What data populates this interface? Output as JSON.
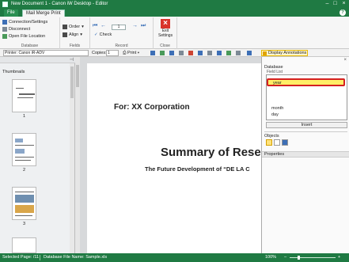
{
  "window": {
    "title": "New Document 1 - Canon iW Desktop - Editor",
    "minimize_glyph": "–",
    "maximize_glyph": "□",
    "close_glyph": "×"
  },
  "tabs": {
    "file": "File",
    "mail_merge_print": "Mail Merge Print",
    "help_glyph": "?"
  },
  "ribbon": {
    "database_group": {
      "label": "Database",
      "items": [
        "Connection/Settings",
        "Disconnect",
        "Open File Location"
      ]
    },
    "fields_group": {
      "label": "Fields",
      "order": "Order",
      "align": "Align"
    },
    "record_group": {
      "label": "Record",
      "check": "Check",
      "record_number": "1"
    },
    "close_group": {
      "label": "Close",
      "exit_line1": "Exit",
      "exit_line2": "Settings"
    }
  },
  "toolbar2": {
    "printer": "Printer: Canon iR-ADV",
    "copies_label": "Copies:",
    "copies_value": "1",
    "print": "Print",
    "display_annotations": "Display Annotations"
  },
  "thumbnails": {
    "label": "Thumbnails",
    "pin_glyph": "⊣",
    "pages": [
      "1",
      "2",
      "3"
    ]
  },
  "document": {
    "for_line": "For: XX Corporation",
    "summary": "Summary of Rese",
    "future": "The Future Development of “DE LA C"
  },
  "right_panel": {
    "close_glyph": "×",
    "database_label": "Database",
    "field_list_label": "Field List",
    "fields": [
      "year",
      "month",
      "day"
    ],
    "selected_field": "year",
    "insert_button": "Insert",
    "objects_label": "Objects",
    "properties_label": "Properties"
  },
  "statusbar": {
    "selected_page": "Selected Page: /11",
    "database_file": "Database File Name: Sample.xls",
    "zoom": "100%",
    "zoom_out": "–",
    "zoom_in": "+"
  },
  "colors": {
    "title_green": "#1f7a43",
    "highlight_yellow": "#ffee66",
    "highlight_border": "#d42020"
  }
}
